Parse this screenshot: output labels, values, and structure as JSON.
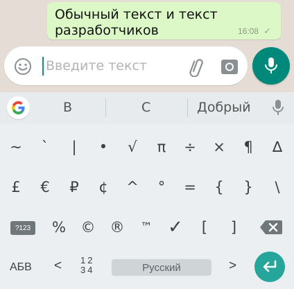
{
  "chat": {
    "message": {
      "text": "Обычный текст и текст разработчиков",
      "time": "16:08",
      "status_glyph": "✓"
    },
    "input": {
      "placeholder": "Введите текст"
    },
    "icons": {
      "emoji": "emoji-icon",
      "attach": "paperclip-icon",
      "camera": "camera-icon",
      "mic": "microphone-icon"
    }
  },
  "keyboard": {
    "suggestions": [
      "В",
      "С",
      "Добрый"
    ],
    "rows": {
      "row1": [
        "~",
        "`",
        "|",
        "•",
        "√",
        "π",
        "÷",
        "×",
        "¶",
        "∆"
      ],
      "row2": [
        "£",
        "€",
        "₽",
        "¢",
        "^",
        "°",
        "=",
        "{",
        "}",
        "\\"
      ],
      "row3": [
        "%",
        "©",
        "®",
        "™",
        "✓",
        "[",
        "]"
      ]
    },
    "bottom": {
      "mode_label": "?123",
      "lang_switch": "АБВ",
      "lt": "<",
      "num_top": "12",
      "num_bottom": "34",
      "space_label": "Русский",
      "gt": ">"
    }
  },
  "colors": {
    "accent": "#00897b",
    "bubble": "#dcf8c6",
    "chat_bg": "#e5ddd5",
    "keyboard_bg": "#eceff1"
  }
}
